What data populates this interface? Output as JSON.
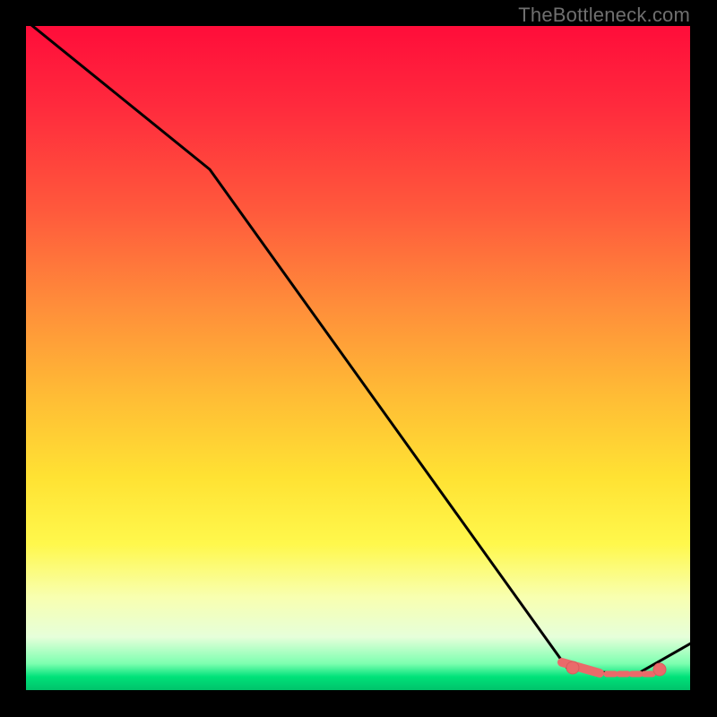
{
  "attribution": "TheBottleneck.com",
  "colors": {
    "line": "#000000",
    "marker_fill": "#ea6a6a",
    "marker_stroke": "#c64d4d",
    "gradient_top": "#ff0d3a",
    "gradient_bottom": "#00c26a",
    "frame_bg": "#000000"
  },
  "chart_data": {
    "type": "line",
    "title": "",
    "xlabel": "",
    "ylabel": "",
    "xlim": [
      0,
      100
    ],
    "ylim": [
      0,
      100
    ],
    "x": [
      0,
      28,
      82,
      92,
      100
    ],
    "y": [
      100,
      78,
      3,
      2,
      7
    ],
    "markers": [
      {
        "x": 82.5,
        "y": 3.3
      },
      {
        "x": 95.5,
        "y": 3.1
      }
    ],
    "notes": "Black curve over heat gradient; two salmon dots near x≈82 and x≈95 at bottom; no axis ticks visible."
  }
}
